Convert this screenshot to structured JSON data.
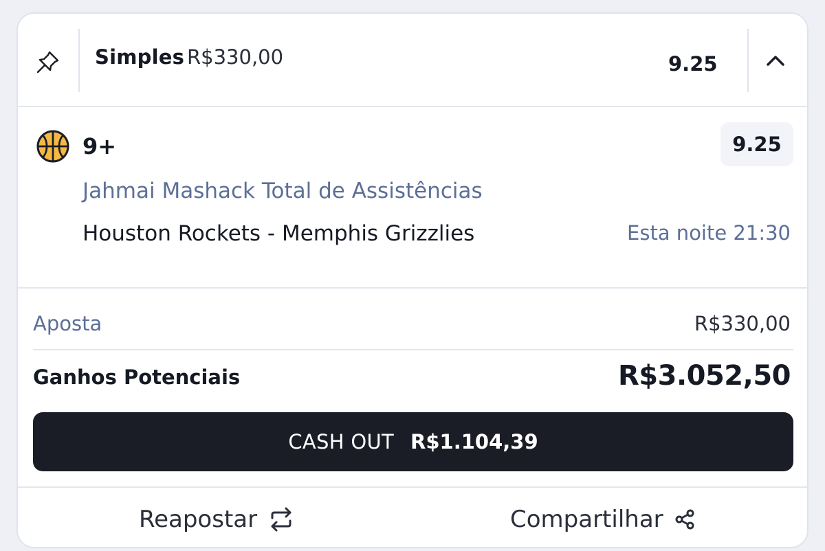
{
  "header": {
    "bet_type": "Simples",
    "stake": "R$330,00",
    "odds": "9.25",
    "pin_icon": "pin-icon",
    "collapse_icon": "chevron-up-icon"
  },
  "selection": {
    "sport_icon": "basketball-icon",
    "name": "9+",
    "odds": "9.25",
    "market": "Jahmai Mashack Total de Assistências",
    "event": "Houston Rockets - Memphis Grizzlies",
    "time": "Esta noite 21:30"
  },
  "summary": {
    "stake_label": "Aposta",
    "stake_value": "R$330,00",
    "potential_label": "Ganhos Potenciais",
    "potential_value": "R$3.052,50"
  },
  "cashout": {
    "label": "CASH OUT",
    "value": "R$1.104,39"
  },
  "footer": {
    "rebet_label": "Reapostar",
    "rebet_icon": "repeat-icon",
    "share_label": "Compartilhar",
    "share_icon": "share-icon"
  },
  "colors": {
    "accent_text": "#5d6f96",
    "button_dark": "#1b1d26",
    "basketball": "#f5b843"
  }
}
